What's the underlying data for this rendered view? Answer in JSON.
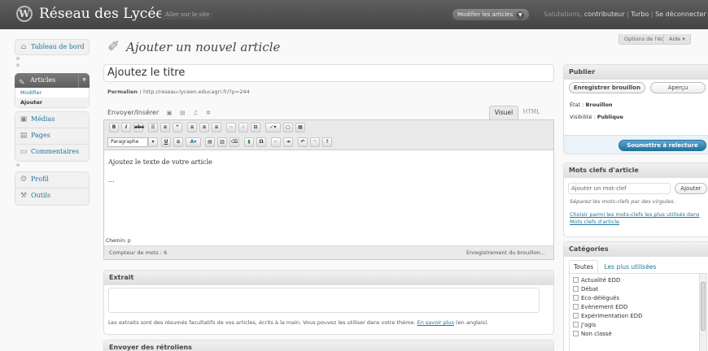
{
  "header": {
    "logo_glyph": "W",
    "site_title": "Réseau des Lycéens",
    "visit_site": "Aller sur le site",
    "favorite_button": "Modifier les articles",
    "greeting": "Salutations,",
    "user": "contributeur",
    "sep1": "|",
    "turbo": "Turbo",
    "sep2": "|",
    "logout": "Se déconnecter"
  },
  "screen_options": {
    "options": "Options de l'écran ▾",
    "help": "Aide ▾"
  },
  "menu": {
    "dashboard": "Tableau de bord",
    "articles": "Articles",
    "articles_sub": [
      "Modifier",
      "Ajouter"
    ],
    "media": "Médias",
    "pages": "Pages",
    "comments": "Commentaires",
    "profile": "Profil",
    "tools": "Outils"
  },
  "page": {
    "title": "Ajouter un nouvel article",
    "title_field_value": "Ajoutez le titre",
    "permalink_label": "Permalien :",
    "permalink_url": "http://reseau-lyceen.educagri.fr/?p=244"
  },
  "editor": {
    "upload_label": "Envoyer/Insérer",
    "tab_visual": "Visuel",
    "tab_html": "HTML",
    "format_select": "Paragraphe",
    "content_line1": "Ajoutez le texte de votre article",
    "content_line2": "...",
    "path": "Chemin: p",
    "word_count": "Compteur de mots : 6",
    "draft_status": "Enregistrement du brouillon..."
  },
  "excerpt": {
    "title": "Extrait",
    "note_before": "Les extraits sont des résumés facultatifs de vos articles, écrits à la main. Vous pouvez les utiliser dans votre thème.",
    "note_link": "En savoir plus",
    "note_after": "(en anglais)."
  },
  "trackbacks": {
    "title": "Envoyer des rétroliens"
  },
  "publish": {
    "title": "Publier",
    "save_draft": "Enregistrer brouillon",
    "preview": "Aperçu",
    "status_label": "État :",
    "status_value": "Brouillon",
    "visibility_label": "Visibilité :",
    "visibility_value": "Publique",
    "submit": "Soumettre à relecture"
  },
  "tags": {
    "title": "Mots clefs d'article",
    "input_placeholder": "Ajouter un mot-clef",
    "add_button": "Ajouter",
    "howto": "Séparez les mots-clefs par des virgules.",
    "choose_link": "Choisir parmi les mots-clefs les plus utilisés dans Mots clefs d'article"
  },
  "categories": {
    "title": "Catégories",
    "tab_all": "Toutes",
    "tab_popular": "Les plus utilisées",
    "items": [
      "Actualité EDD",
      "Débat",
      "Eco-délégués",
      "Evènement EDD",
      "Expérimentation EDD",
      "J'agis",
      "Non classé"
    ]
  },
  "colors": {
    "header": "#464646",
    "link": "#21759b",
    "primary_button": "#21759b"
  }
}
